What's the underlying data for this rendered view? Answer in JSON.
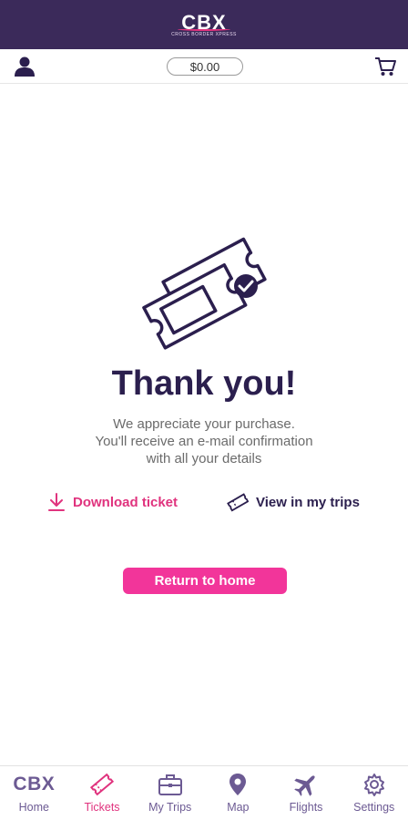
{
  "header": {
    "logo_text": "CBX",
    "logo_subtext": "CROSS BORDER XPRESS"
  },
  "toolbar": {
    "balance": "$0.00"
  },
  "confirmation": {
    "title": "Thank you!",
    "message_line1": "We appreciate your purchase.",
    "message_line2": "You'll receive an e-mail confirmation",
    "message_line3": "with all your details"
  },
  "actions": {
    "download_label": "Download ticket",
    "view_trips_label": "View in my trips",
    "return_label": "Return to home"
  },
  "tabbar": {
    "items": [
      {
        "label": "Home",
        "icon": "cbx-logo-icon",
        "active": false
      },
      {
        "label": "Tickets",
        "icon": "ticket-icon",
        "active": true
      },
      {
        "label": "My Trips",
        "icon": "briefcase-icon",
        "active": false
      },
      {
        "label": "Map",
        "icon": "map-pin-icon",
        "active": false
      },
      {
        "label": "Flights",
        "icon": "airplane-icon",
        "active": false
      },
      {
        "label": "Settings",
        "icon": "gear-icon",
        "active": false
      }
    ],
    "home_logo_text": "CBX"
  },
  "colors": {
    "header_bg": "#3b2a5a",
    "accent_pink": "#f2359a",
    "link_pink": "#e0337e",
    "dark_purple": "#2b1f4e",
    "tab_purple": "#6c5a93"
  }
}
